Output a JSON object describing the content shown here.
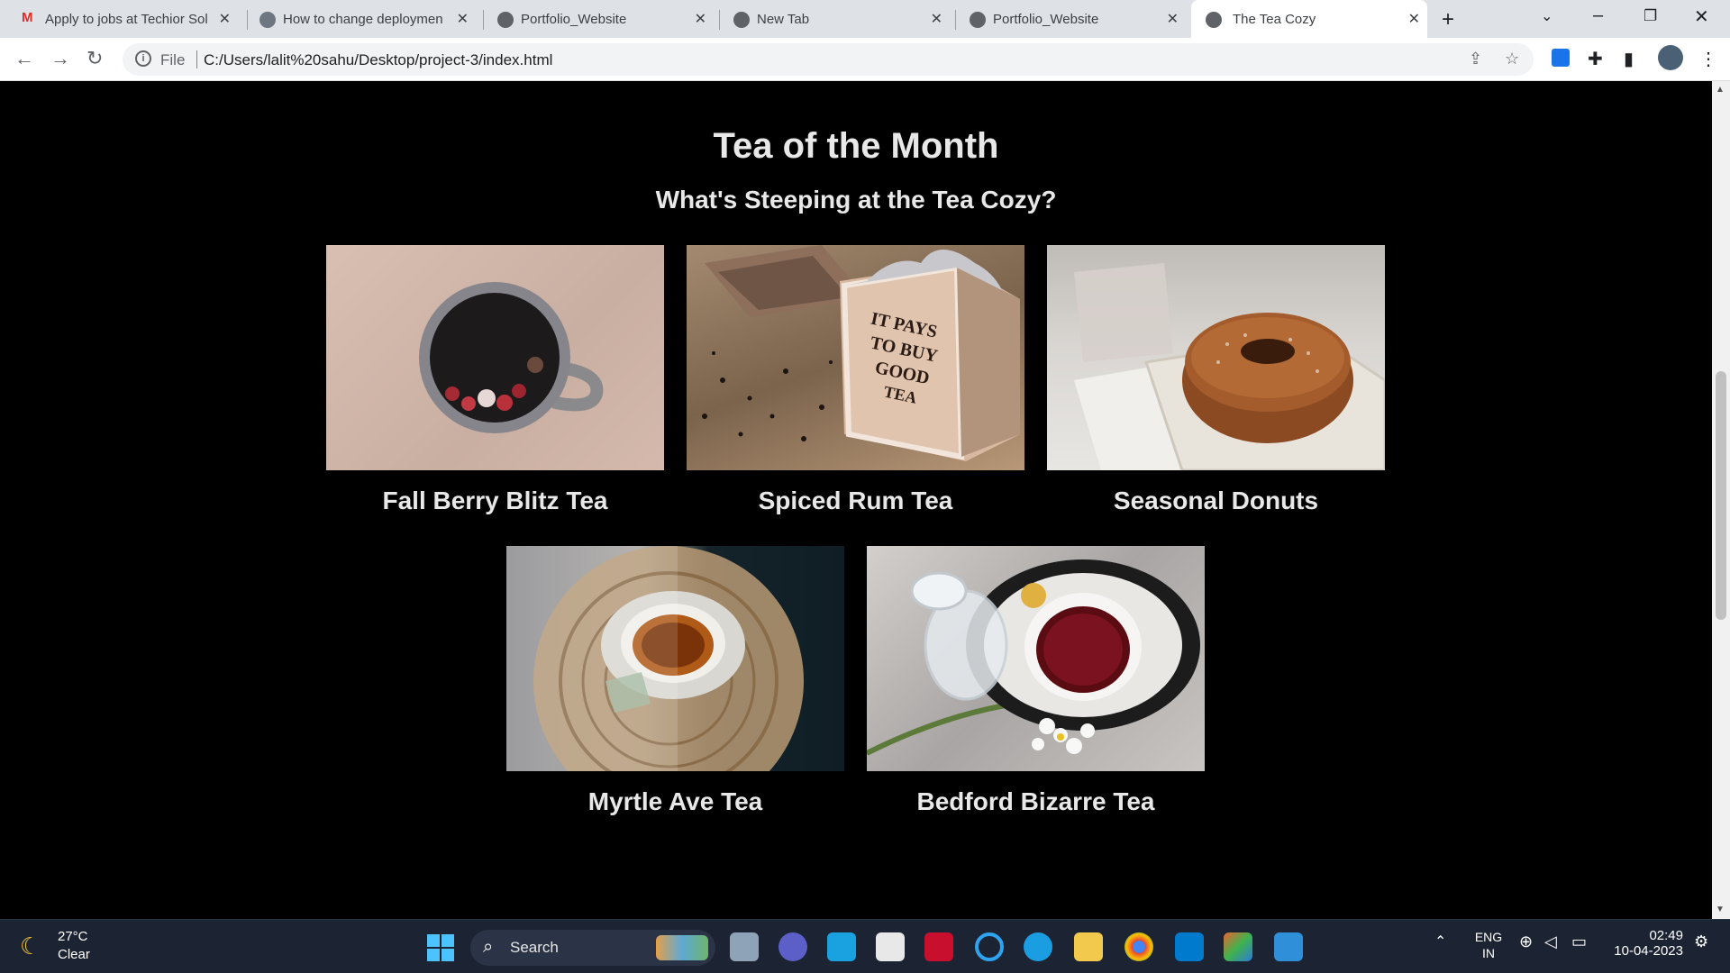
{
  "browser": {
    "tabs": [
      {
        "title": "Apply to jobs at Techior Sol",
        "icon": "gmail-icon"
      },
      {
        "title": "How to change deploymen",
        "icon": "github-icon"
      },
      {
        "title": "Portfolio_Website",
        "icon": "globe-icon"
      },
      {
        "title": "New Tab",
        "icon": "globe-icon"
      },
      {
        "title": "Portfolio_Website",
        "icon": "globe-icon"
      },
      {
        "title": "The Tea Cozy",
        "icon": "globe-icon",
        "active": true
      }
    ],
    "omnibox": {
      "scheme_label": "File",
      "url": "C:/Users/lalit%20sahu/Desktop/project-3/index.html"
    }
  },
  "page": {
    "heading": "Tea of the Month",
    "subheading": "What's Steeping at the Tea Cozy?",
    "items": [
      {
        "caption": "Fall Berry Blitz Tea"
      },
      {
        "caption": "Spiced Rum Tea"
      },
      {
        "caption": "Seasonal Donuts"
      },
      {
        "caption": "Myrtle Ave Tea"
      },
      {
        "caption": "Bedford Bizarre Tea"
      }
    ],
    "box_text": "IT PAYS TO BUY GOOD TEA"
  },
  "taskbar": {
    "weather": {
      "temp": "27°C",
      "desc": "Clear"
    },
    "search_label": "Search",
    "lang": {
      "line1": "ENG",
      "line2": "IN"
    },
    "time": "02:49",
    "date": "10-04-2023"
  }
}
